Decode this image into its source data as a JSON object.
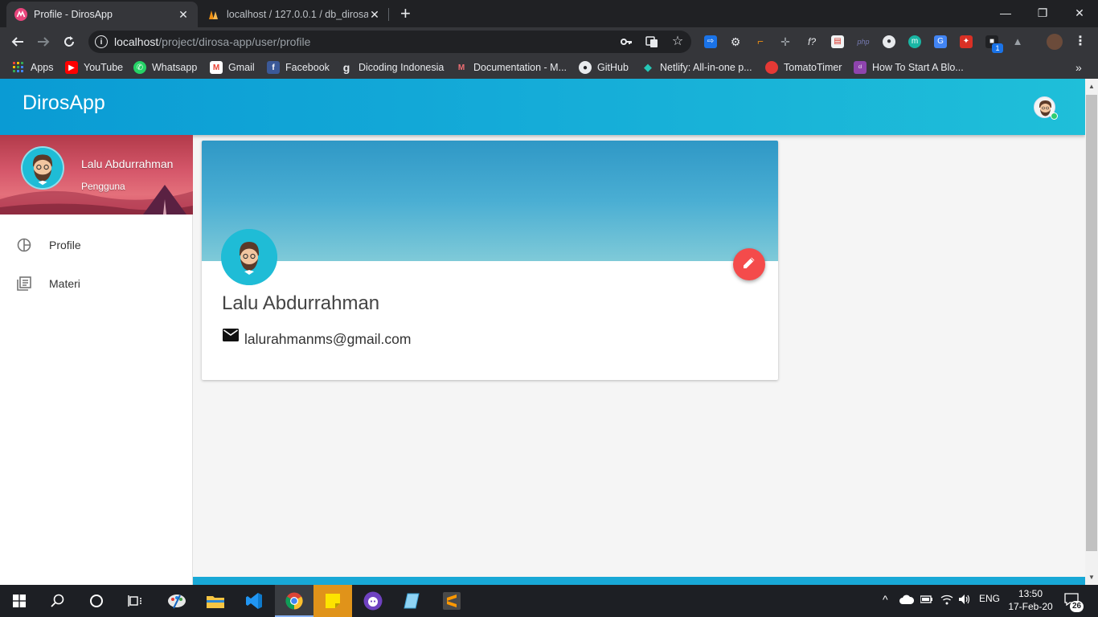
{
  "browser": {
    "tabs": [
      {
        "title": "Profile - DirosApp",
        "active": true
      },
      {
        "title": "localhost / 127.0.0.1 / db_dirosa_",
        "active": false
      }
    ],
    "url_host": "localhost",
    "url_path": "/project/dirosa-app/user/profile",
    "bookmarks": [
      {
        "label": "Apps",
        "icon": "apps-grid-icon"
      },
      {
        "label": "YouTube",
        "icon": "youtube-icon"
      },
      {
        "label": "Whatsapp",
        "icon": "whatsapp-icon"
      },
      {
        "label": "Gmail",
        "icon": "gmail-icon"
      },
      {
        "label": "Facebook",
        "icon": "facebook-icon"
      },
      {
        "label": "Dicoding Indonesia",
        "icon": "dicoding-icon"
      },
      {
        "label": "Documentation - M...",
        "icon": "materialize-icon"
      },
      {
        "label": "GitHub",
        "icon": "github-icon"
      },
      {
        "label": "Netlify: All-in-one p...",
        "icon": "netlify-icon"
      },
      {
        "label": "TomatoTimer",
        "icon": "tomato-icon"
      },
      {
        "label": "How To Start A Blo...",
        "icon": "colorlib-icon"
      }
    ],
    "more_bookmarks": "»"
  },
  "app": {
    "brand": "DirosApp",
    "accent": "#15acd8",
    "fab_color": "#f44b4b",
    "user": {
      "name": "Lalu Abdurrahman",
      "role": "Pengguna",
      "email": "lalurahmanms@gmail.com"
    },
    "nav": [
      {
        "label": "Profile",
        "icon": "pie-chart-icon"
      },
      {
        "label": "Materi",
        "icon": "library-books-icon"
      }
    ]
  },
  "taskbar": {
    "language": "ENG",
    "time": "13:50",
    "date": "17-Feb-20",
    "notification_count": "26"
  }
}
